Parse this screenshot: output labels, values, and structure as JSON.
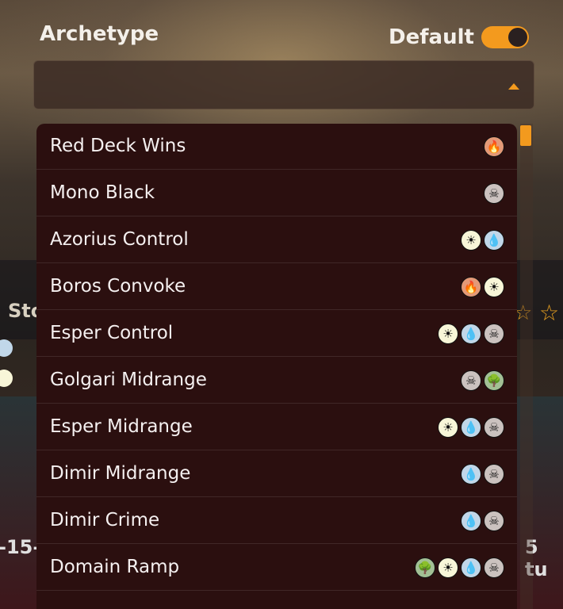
{
  "header": {
    "archetype_label": "Archetype",
    "default_label": "Default",
    "default_toggle_on": true
  },
  "select": {
    "value": "",
    "caret": "caret-up-icon"
  },
  "background": {
    "left_text": "Sto",
    "left_date": "-15-",
    "right_text": "5 tu"
  },
  "mana_colors": {
    "red": "#e49977",
    "black": "#cbc2bf",
    "white": "#f8f6d8",
    "blue": "#c1d7e9",
    "green": "#a3c095"
  },
  "mana_glyphs": {
    "red": "🔥",
    "black": "☠",
    "white": "☀",
    "blue": "💧",
    "green": "🌳"
  },
  "options": [
    {
      "label": "Red Deck Wins",
      "colors": [
        "red"
      ]
    },
    {
      "label": "Mono Black",
      "colors": [
        "black"
      ]
    },
    {
      "label": "Azorius Control",
      "colors": [
        "white",
        "blue"
      ]
    },
    {
      "label": "Boros Convoke",
      "colors": [
        "red",
        "white"
      ]
    },
    {
      "label": "Esper Control",
      "colors": [
        "white",
        "blue",
        "black"
      ]
    },
    {
      "label": "Golgari Midrange",
      "colors": [
        "black",
        "green"
      ]
    },
    {
      "label": "Esper Midrange",
      "colors": [
        "white",
        "blue",
        "black"
      ]
    },
    {
      "label": "Dimir Midrange",
      "colors": [
        "blue",
        "black"
      ]
    },
    {
      "label": "Dimir Crime",
      "colors": [
        "blue",
        "black"
      ]
    },
    {
      "label": "Domain Ramp",
      "colors": [
        "green",
        "white",
        "blue",
        "black"
      ]
    }
  ]
}
